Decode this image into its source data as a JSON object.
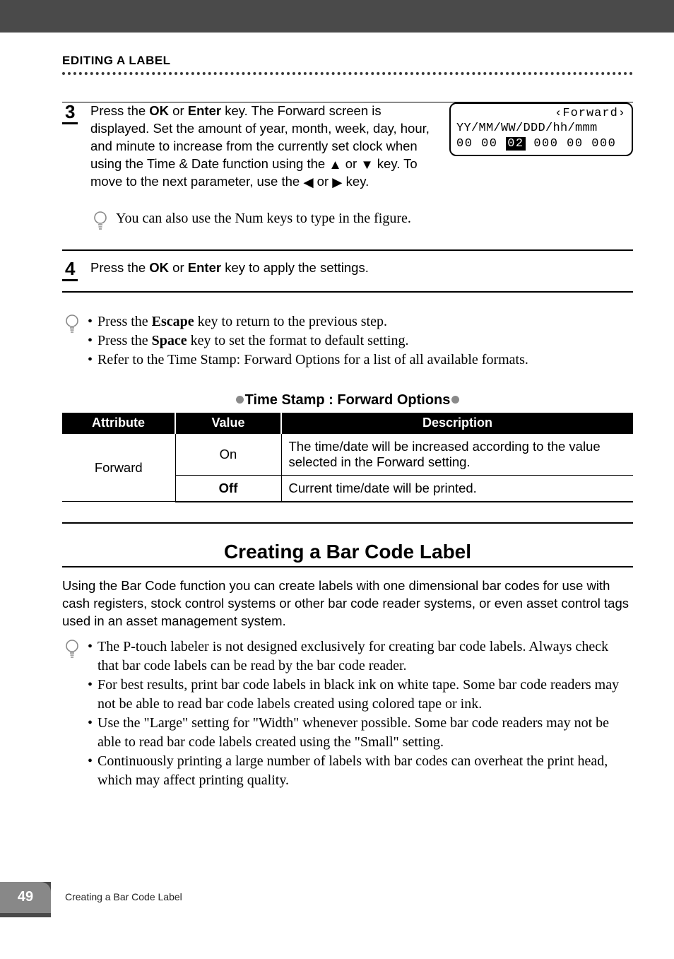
{
  "header": {
    "category": "EDITING A LABEL"
  },
  "steps": {
    "s3": {
      "num": "3",
      "part1": "Press the ",
      "k1": "OK",
      "mid1": " or ",
      "k2": "Enter",
      "part2": " key. The Forward screen is displayed. Set the amount of year, month, week, day, hour, and minute to increase from the currently set clock when using the Time & Date function using the ",
      "part3": " or ",
      "part4": " key. To move to the next parameter, use the ",
      "part5": " or ",
      "part6": " key."
    },
    "s4": {
      "num": "4",
      "part1": "Press the ",
      "k1": "OK",
      "mid1": " or ",
      "k2": "Enter",
      "part2": " key to apply the settings."
    }
  },
  "lcd": {
    "title": "‹Forward›",
    "line2": "YY/MM/WW/DDD/hh/mmm",
    "l3a": "00 00 ",
    "l3sel": "02",
    "l3b": " 000 00 000"
  },
  "tip1": "You can also use the Num keys to type in the figure.",
  "tips_block": {
    "t1a": "Press the ",
    "t1k": "Escape",
    "t1b": " key to return to the previous step.",
    "t2a": "Press the ",
    "t2k": "Space",
    "t2b": " key to set the format to default setting.",
    "t3": "Refer to the Time Stamp: Forward Options for a list of all available formats."
  },
  "table": {
    "title": "Time Stamp : Forward Options",
    "headers": {
      "c1": "Attribute",
      "c2": "Value",
      "c3": "Description"
    },
    "attr": "Forward",
    "row1": {
      "value": "On",
      "desc": "The time/date will be increased according to the value selected in the Forward setting."
    },
    "row2": {
      "value": "Off",
      "desc": "Current time/date will be printed."
    }
  },
  "section": {
    "title": "Creating a Bar Code Label",
    "intro": "Using the Bar Code function you can create labels with one dimensional bar codes for use with cash registers, stock control systems or other bar code reader systems, or even asset control tags used in an asset management system.",
    "notes": {
      "n1": "The P-touch labeler is not designed exclusively for creating bar code labels. Always check that bar code labels can be read by the bar code reader.",
      "n2": "For best results, print bar code labels in black ink on white tape. Some bar code readers may not be able to read bar code labels created using colored tape or ink.",
      "n3": "Use the \"Large\" setting for \"Width\" whenever possible. Some bar code readers may not be able to read bar code labels created using the \"Small\" setting.",
      "n4": "Continuously printing a large number of labels with bar codes can overheat the print head, which may affect printing quality."
    }
  },
  "footer": {
    "page": "49",
    "text": "Creating a Bar Code Label"
  }
}
